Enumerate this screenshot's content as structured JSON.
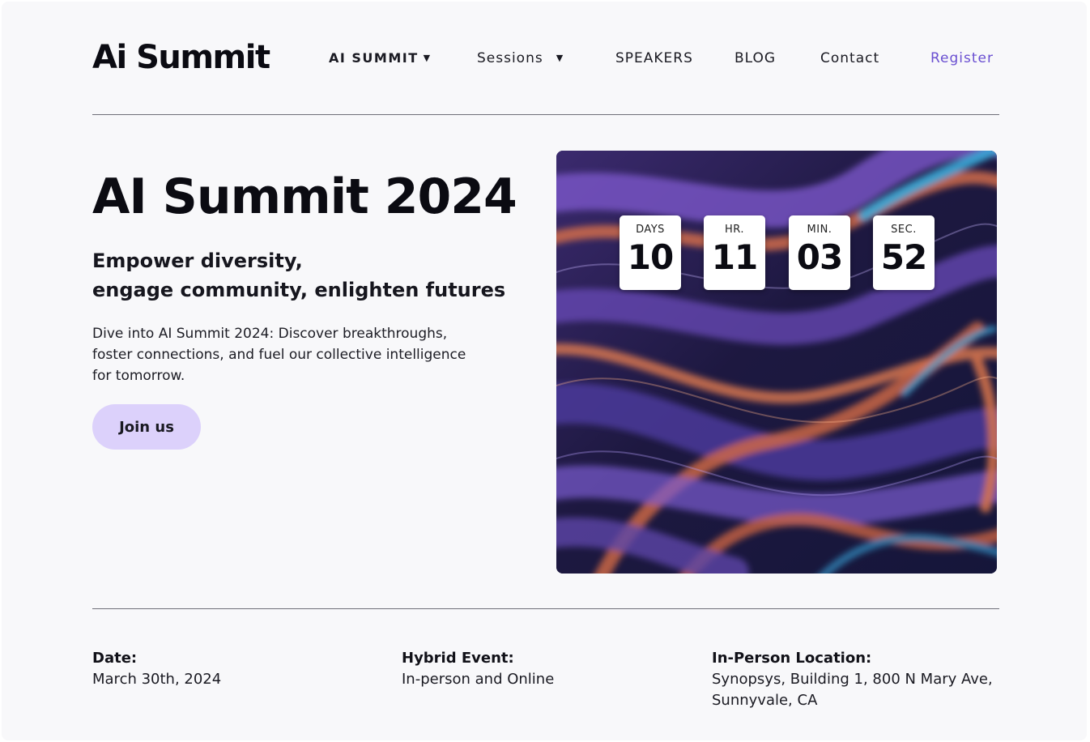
{
  "header": {
    "logo": "Ai Summit",
    "nav": {
      "ai_summit": "AI SUMMIT",
      "sessions": "Sessions",
      "speakers": "SPEAKERS",
      "blog": "BLOG",
      "contact": "Contact",
      "register": "Register"
    }
  },
  "hero": {
    "title": "AI Summit 2024",
    "tagline": [
      "Empower diversity,",
      "engage community, enlighten futures"
    ],
    "description": [
      "Dive into AI Summit 2024: Discover breakthroughs,",
      "foster connections, and fuel our collective intelligence",
      "for tomorrow."
    ],
    "cta_label": "Join us"
  },
  "countdown": [
    {
      "label": "DAYS",
      "value": "10"
    },
    {
      "label": "HR.",
      "value": "11"
    },
    {
      "label": "MIN.",
      "value": "03"
    },
    {
      "label": "SEC.",
      "value": "52"
    }
  ],
  "details": {
    "date": {
      "label": "Date:",
      "value": [
        "March 30th, 2024"
      ]
    },
    "event": {
      "label": "Hybrid Event:",
      "value": [
        "In-person and Online"
      ]
    },
    "location": {
      "label": "In-Person Location:",
      "value": [
        "Synopsys, Building 1, 800 N Mary Ave,",
        "Sunnyvale, CA"
      ]
    }
  },
  "colors": {
    "accent": "#6a4fd1",
    "cta_background": "#dcd1fb",
    "page_background": "#f8f8fa"
  },
  "icons": {
    "caret": "caret-down-icon"
  }
}
